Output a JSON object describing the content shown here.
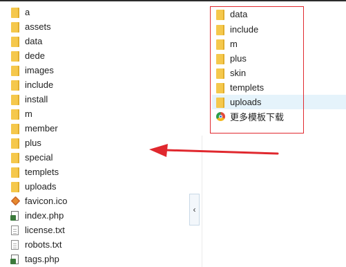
{
  "left_pane": {
    "items": [
      {
        "name": "a",
        "type": "folder"
      },
      {
        "name": "assets",
        "type": "folder"
      },
      {
        "name": "data",
        "type": "folder"
      },
      {
        "name": "dede",
        "type": "folder"
      },
      {
        "name": "images",
        "type": "folder"
      },
      {
        "name": "include",
        "type": "folder"
      },
      {
        "name": "install",
        "type": "folder"
      },
      {
        "name": "m",
        "type": "folder"
      },
      {
        "name": "member",
        "type": "folder"
      },
      {
        "name": "plus",
        "type": "folder"
      },
      {
        "name": "special",
        "type": "folder"
      },
      {
        "name": "templets",
        "type": "folder"
      },
      {
        "name": "uploads",
        "type": "folder"
      },
      {
        "name": "favicon.ico",
        "type": "ico"
      },
      {
        "name": "index.php",
        "type": "php"
      },
      {
        "name": "license.txt",
        "type": "txt"
      },
      {
        "name": "robots.txt",
        "type": "txt"
      },
      {
        "name": "tags.php",
        "type": "php"
      }
    ]
  },
  "right_pane": {
    "items": [
      {
        "name": "data",
        "type": "folder"
      },
      {
        "name": "include",
        "type": "folder"
      },
      {
        "name": "m",
        "type": "folder"
      },
      {
        "name": "plus",
        "type": "folder"
      },
      {
        "name": "skin",
        "type": "folder"
      },
      {
        "name": "templets",
        "type": "folder"
      },
      {
        "name": "uploads",
        "type": "folder",
        "hover": true
      },
      {
        "name": "更多模板下载",
        "type": "app"
      }
    ]
  },
  "collapse_button": {
    "glyph": "‹",
    "icon": "chevron-left-icon"
  },
  "annotation": {
    "highlight_color": "#e0282e",
    "arrow_color": "#e0282e"
  },
  "colors": {
    "folder": "#f5c84c",
    "hover": "#e5f3fb"
  }
}
